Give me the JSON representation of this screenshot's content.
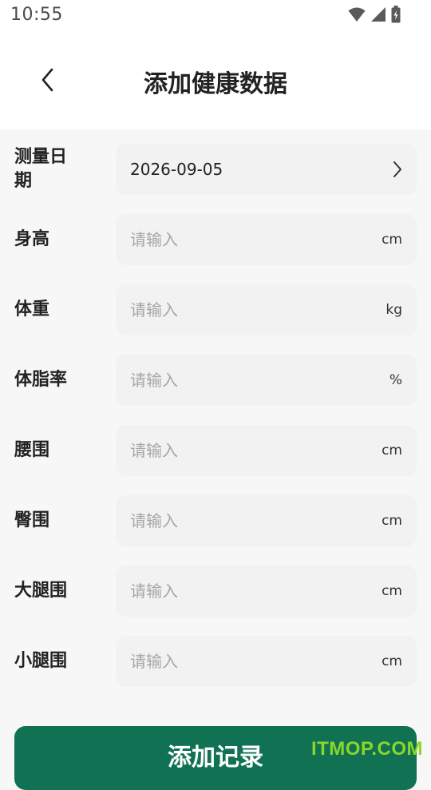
{
  "status": {
    "time": "10:55"
  },
  "header": {
    "title": "添加健康数据"
  },
  "form": {
    "date": {
      "label_line1": "测量日",
      "label_line2": "期",
      "value": "2026-09-05"
    },
    "fields": [
      {
        "label": "身高",
        "placeholder": "请输入",
        "unit": "cm"
      },
      {
        "label": "体重",
        "placeholder": "请输入",
        "unit": "kg"
      },
      {
        "label": "体脂率",
        "placeholder": "请输入",
        "unit": "%"
      },
      {
        "label": "腰围",
        "placeholder": "请输入",
        "unit": "cm"
      },
      {
        "label": "臀围",
        "placeholder": "请输入",
        "unit": "cm"
      },
      {
        "label": "大腿围",
        "placeholder": "请输入",
        "unit": "cm"
      },
      {
        "label": "小腿围",
        "placeholder": "请输入",
        "unit": "cm"
      }
    ]
  },
  "submit_label": "添加记录",
  "watermark": "ITMOP.COM",
  "colors": {
    "primary": "#107253",
    "field_bg": "#f2f2f2",
    "page_bg": "#f7f7f7"
  },
  "icons": {
    "back": "chevron-left-icon",
    "date_arrow": "chevron-right-icon"
  }
}
